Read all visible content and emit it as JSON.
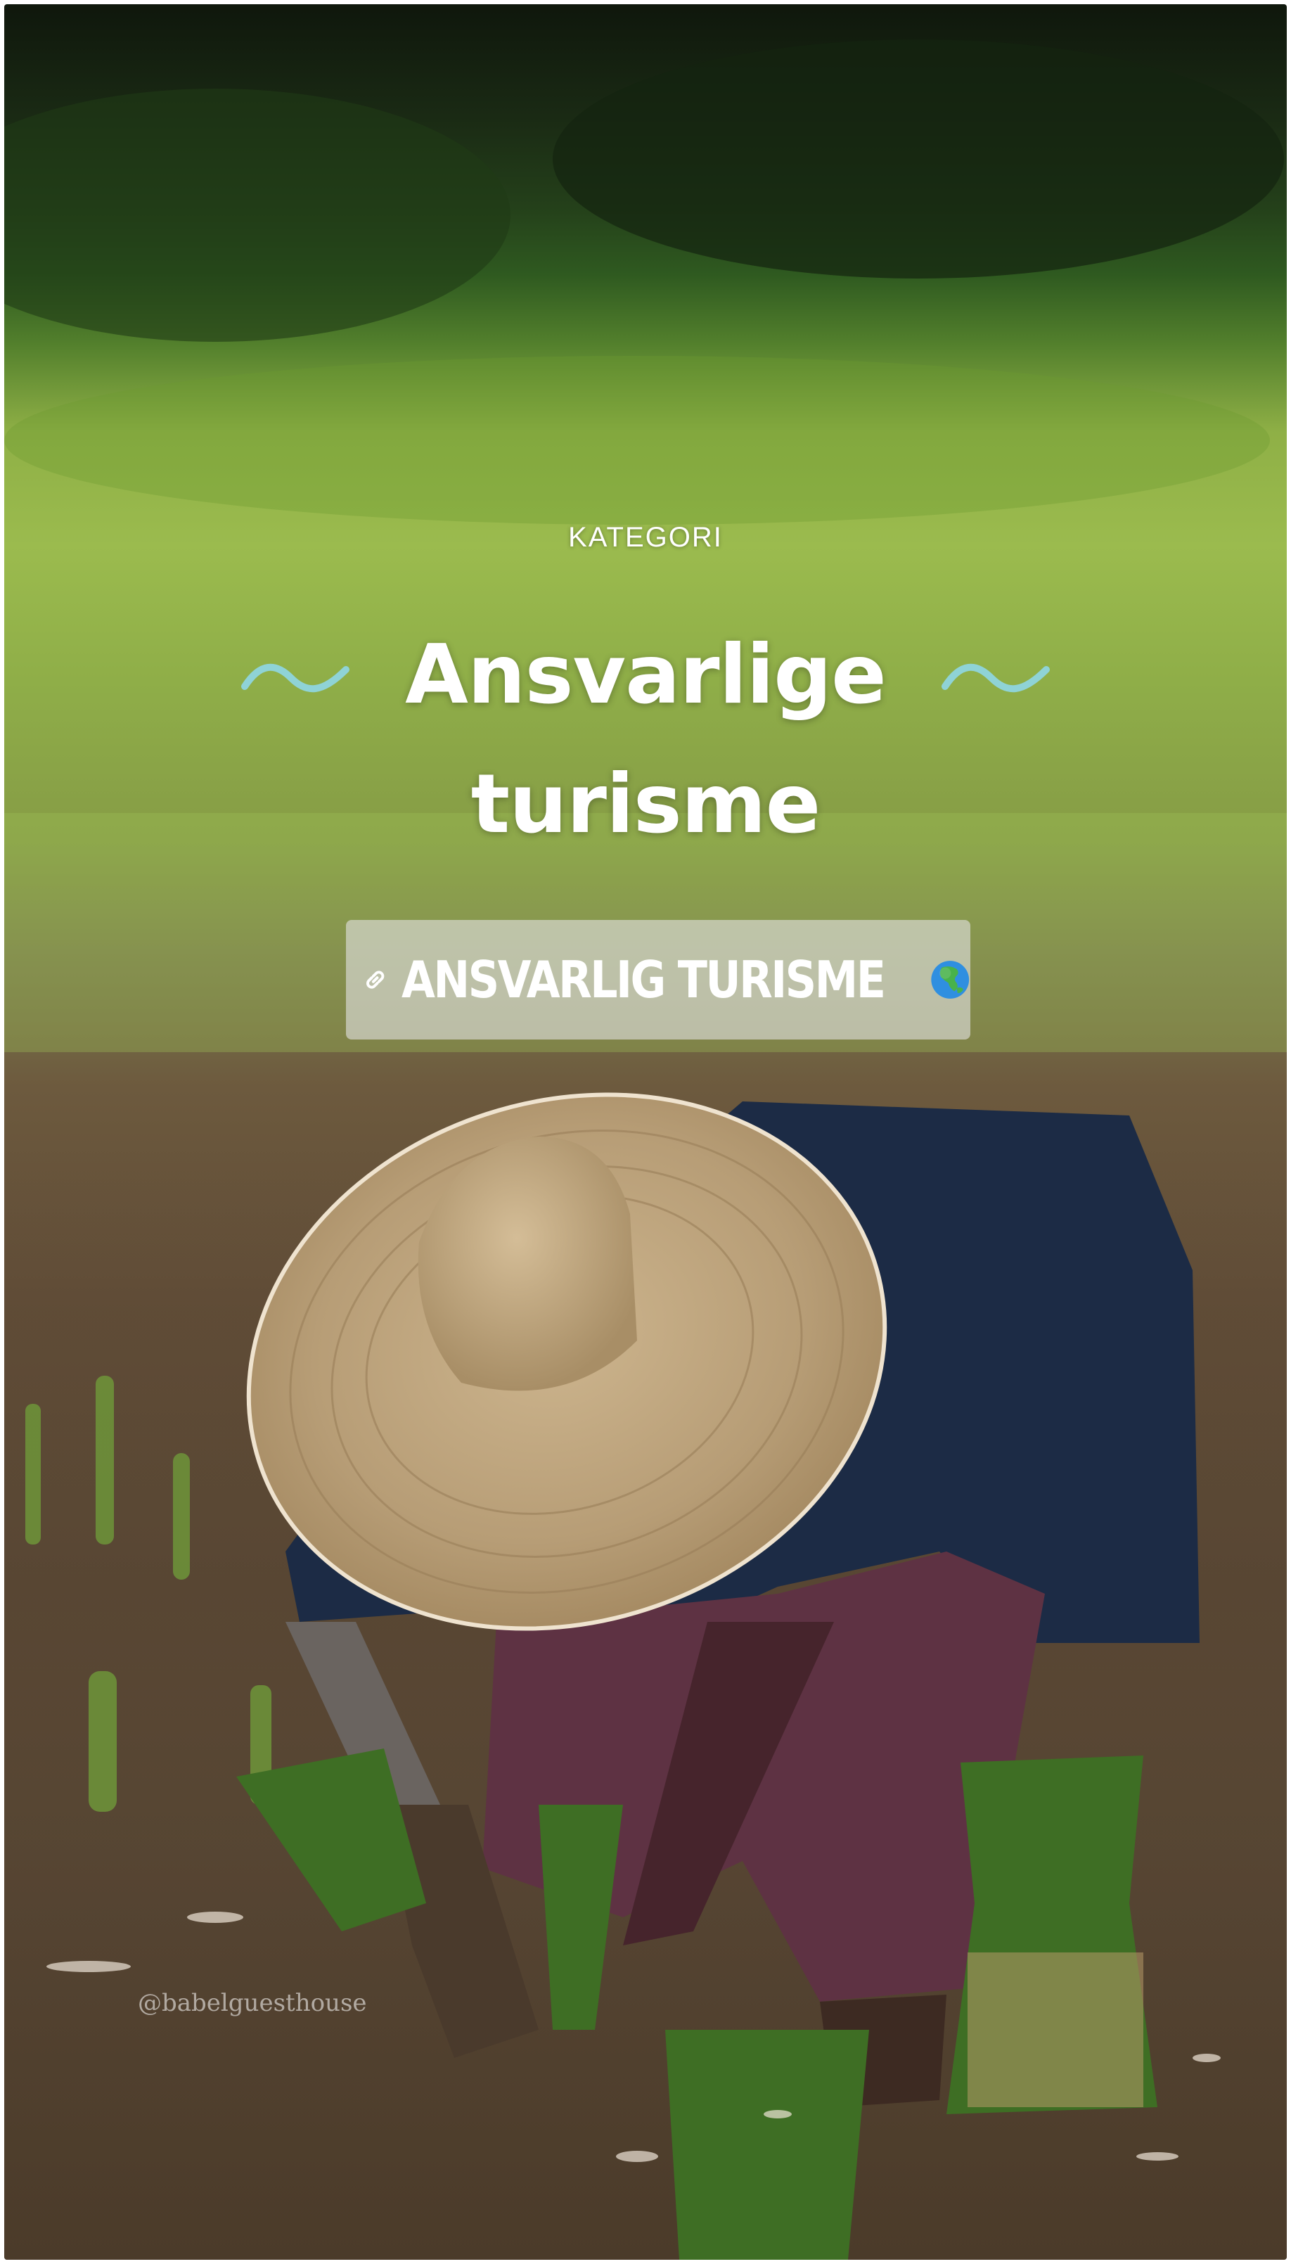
{
  "story": {
    "category_label": "KATEGORI",
    "title_line1": "Ansvarlige",
    "title_line2": "turisme",
    "link_sticker": {
      "label": "ANSVARLIG TURISME",
      "leading_icon": "link-icon",
      "trailing_icon": "globe-asia-emoji-icon"
    },
    "watermark": "@babelguesthouse",
    "colors": {
      "wave_accent": "#8fd3d6",
      "text": "#ffffff",
      "sticker_bg": "rgba(225,225,225,0.62)"
    }
  }
}
